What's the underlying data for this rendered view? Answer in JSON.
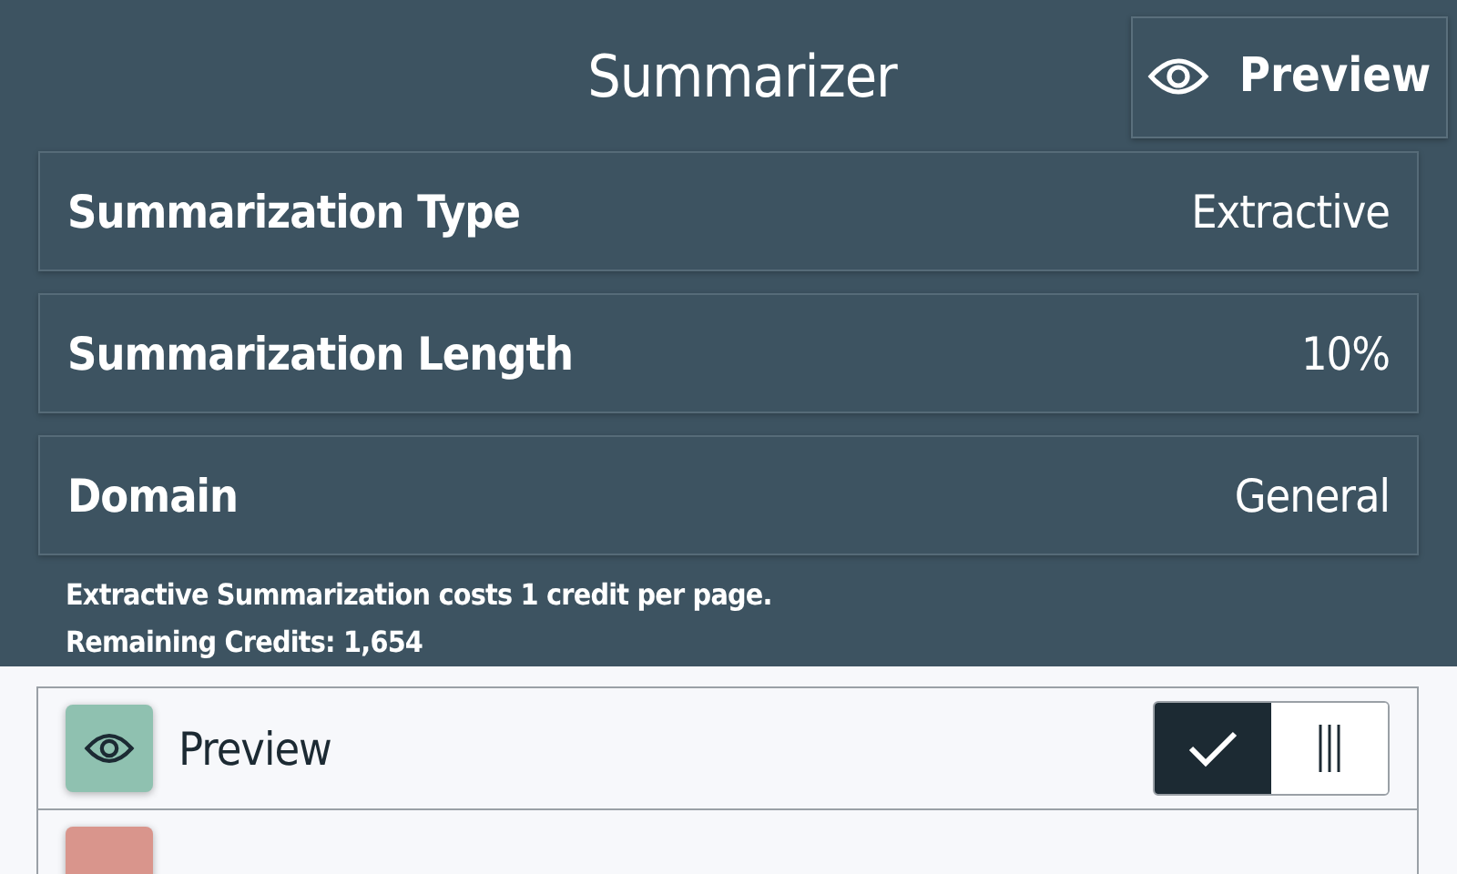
{
  "header": {
    "title": "Summarizer",
    "preview_button": "Preview"
  },
  "settings": [
    {
      "label": "Summarization Type",
      "value": "Extractive"
    },
    {
      "label": "Summarization Length",
      "value": "10%"
    },
    {
      "label": "Domain",
      "value": "General"
    }
  ],
  "info": [
    "Extractive Summarization costs 1 credit per page.",
    "Remaining Credits: 1,654"
  ],
  "items": [
    {
      "label": "Preview",
      "color": "#8fc1b0",
      "on": true
    },
    {
      "color": "#d9958c"
    }
  ]
}
